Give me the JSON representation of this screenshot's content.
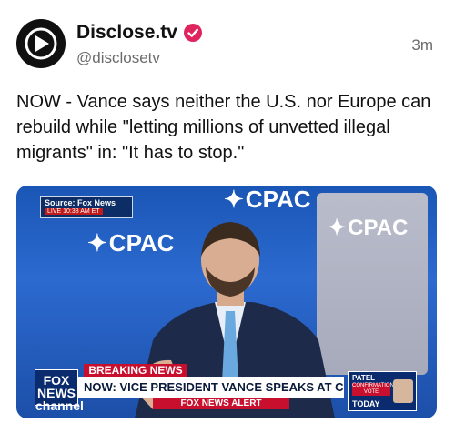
{
  "post": {
    "display_name": "Disclose.tv",
    "handle": "@disclosetv",
    "timestamp": "3m",
    "verified": true,
    "text": "NOW - Vance says neither the U.S. nor Europe can rebuild while \"letting millions of unvetted illegal migrants\" in: \"It has to stop.\""
  },
  "media": {
    "source_tag": "Source: Fox News",
    "live_tag": "LIVE 10:38 AM ET",
    "stage_brand": "CPAC",
    "breaking_label": "BREAKING NEWS",
    "headline": "NOW: VICE PRESIDENT VANCE SPEAKS AT CPAC",
    "alert_label": "FOX NEWS ALERT",
    "network_logo_text": "FOX NEWS channel",
    "today_box": {
      "name": "PATEL",
      "tag": "CONFIRMATION VOTE",
      "label": "TODAY"
    }
  },
  "icons": {
    "avatar": "disclose-play-logo-icon",
    "verified": "verified-badge-icon"
  },
  "colors": {
    "verified_badge": "#e0245e",
    "muted_text": "#6b6b6b",
    "fox_red": "#c8102e",
    "fox_navy": "#0a2b6e"
  }
}
